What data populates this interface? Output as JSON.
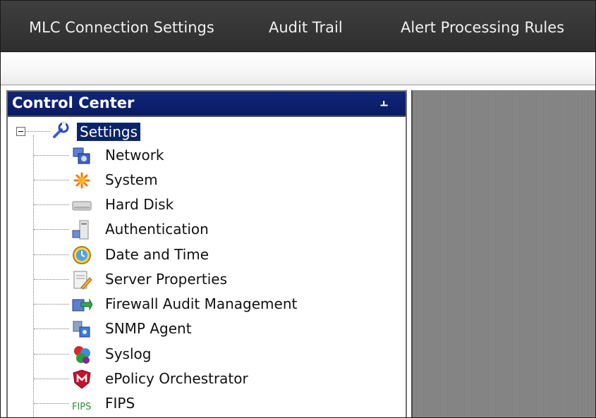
{
  "tabs": [
    {
      "label": "MLC Connection Settings"
    },
    {
      "label": "Audit Trail"
    },
    {
      "label": "Alert Processing Rules"
    }
  ],
  "panel": {
    "title": "Control Center",
    "pin_icon": "pin-icon"
  },
  "tree": {
    "root": {
      "label": "Settings",
      "icon": "wrench-icon",
      "selected": true,
      "expanded": true
    },
    "items": [
      {
        "label": "Network",
        "icon": "network-icon"
      },
      {
        "label": "System",
        "icon": "system-gear-icon"
      },
      {
        "label": "Hard Disk",
        "icon": "hard-disk-icon"
      },
      {
        "label": "Authentication",
        "icon": "authentication-icon"
      },
      {
        "label": "Date and Time",
        "icon": "clock-icon"
      },
      {
        "label": "Server Properties",
        "icon": "server-properties-icon"
      },
      {
        "label": "Firewall Audit Management",
        "icon": "firewall-audit-icon"
      },
      {
        "label": "SNMP Agent",
        "icon": "snmp-agent-icon"
      },
      {
        "label": "Syslog",
        "icon": "syslog-icon"
      },
      {
        "label": "ePolicy Orchestrator",
        "icon": "mcafee-shield-icon"
      },
      {
        "label": "FIPS",
        "icon": "fips-icon"
      }
    ]
  },
  "colors": {
    "selection": "#0a246a",
    "panel_header": "#0a1b63",
    "tabbar": "#333333"
  }
}
